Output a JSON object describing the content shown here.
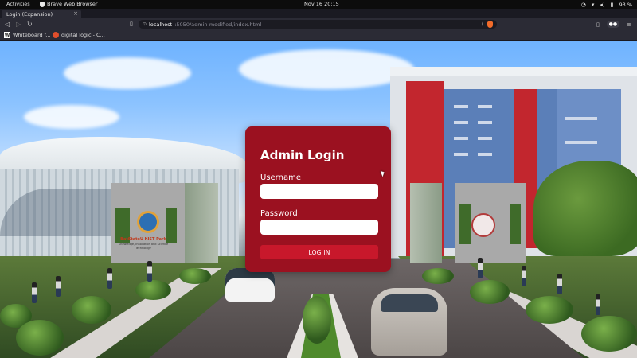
{
  "system_bar": {
    "activities": "Activities",
    "app_name": "Brave Web Browser",
    "clock": "Nov 16  20:15",
    "battery": "93 %"
  },
  "browser": {
    "tab_title": "Login (Expansion)",
    "new_tab": "+",
    "url_host": "localhost",
    "url_path": ":5050/admin-modified/index.html",
    "bookmarks": [
      {
        "label": "Whiteboard f...",
        "icon": "whiteboard-icon"
      },
      {
        "label": "digital logic - C...",
        "icon": "digital-logic-icon"
      }
    ]
  },
  "login": {
    "title": "Admin Login",
    "username_label": "Username",
    "username_value": "",
    "password_label": "Password",
    "password_value": "",
    "button_label": "LOG IN"
  },
  "gate_sign": {
    "line1": "BatStateU KIST Park",
    "line2": "Knowledge, Innovation and Science Technology"
  },
  "colors": {
    "card": "#9b1120",
    "button": "#c8182b",
    "input": "#ffffff"
  }
}
